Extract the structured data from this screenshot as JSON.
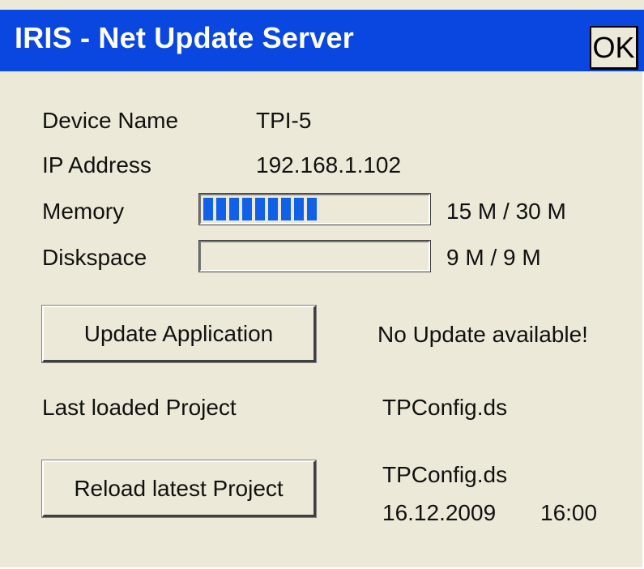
{
  "window": {
    "title": "IRIS - Net Update Server",
    "ok_label": "OK"
  },
  "info": {
    "device_name_label": "Device Name",
    "device_name_value": "TPI-5",
    "ip_label": "IP Address",
    "ip_value": "192.168.1.102",
    "memory_label": "Memory",
    "memory_value": "15 M / 30 M",
    "memory_fraction": 0.5,
    "diskspace_label": "Diskspace",
    "diskspace_value": "9 M / 9 M",
    "diskspace_fraction": 0.0
  },
  "update": {
    "button_label": "Update Application",
    "status": "No Update available!"
  },
  "project": {
    "last_loaded_label": "Last loaded Project",
    "last_loaded_value": "TPConfig.ds",
    "reload_button_label": "Reload latest Project",
    "latest_name": "TPConfig.ds",
    "latest_date": "16.12.2009",
    "latest_time": "16:00"
  },
  "colors": {
    "titlebar": "#0A47E0",
    "background": "#ECE9D8",
    "progress": "#1060E8"
  }
}
